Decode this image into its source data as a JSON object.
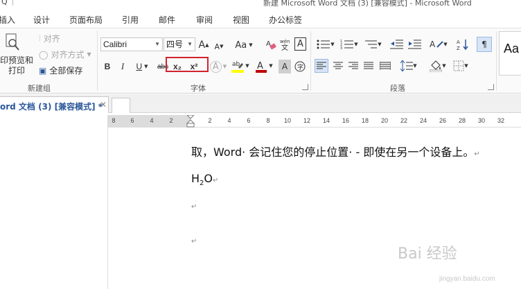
{
  "window": {
    "title": "新建 Microsoft Word 文档 (3) [兼容模式] - Microsoft Word"
  },
  "ribbon_tabs": [
    "插入",
    "设计",
    "页面布局",
    "引用",
    "邮件",
    "审阅",
    "视图",
    "办公标签"
  ],
  "groups": {
    "new": {
      "label": "新建组",
      "preview_print": "印预览和\n打印",
      "align": "对齐",
      "align_mode": "对齐方式",
      "save_all": "全部保存"
    },
    "font": {
      "label": "字体",
      "font_name": "Calibri",
      "font_size": "四号",
      "bold": "B",
      "italic": "I",
      "underline": "U",
      "strike": "abc",
      "subscript": "x₂",
      "superscript": "x²",
      "grow": "A",
      "shrink": "A",
      "change_case": "Aa",
      "char_border": "A"
    },
    "paragraph": {
      "label": "段落"
    },
    "styles": {
      "preview": "Aa"
    }
  },
  "doc_tabs": [
    {
      "label": "ord 文档 (3) [兼容模式] *"
    }
  ],
  "ruler": {
    "labels": [
      "8",
      "6",
      "4",
      "2",
      "2",
      "4",
      "6",
      "8",
      "10",
      "12",
      "14",
      "16",
      "18",
      "20",
      "22",
      "24",
      "26",
      "28",
      "30",
      "32"
    ]
  },
  "document": {
    "line1": "取，Word· 会记住您的停止位置· - 即使在另一个设备上。",
    "line2_base": "H",
    "line2_sub": "2",
    "line2_tail": "O"
  },
  "watermark": {
    "text": "Bai 经验",
    "sub": "jingyan.baidu.com"
  }
}
